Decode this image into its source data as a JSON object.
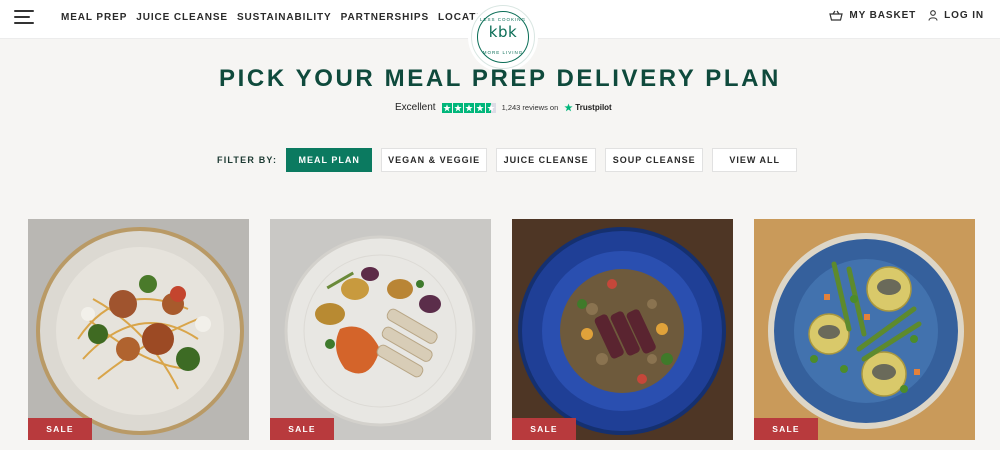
{
  "nav": {
    "items": [
      "MEAL PREP",
      "JUICE CLEANSE",
      "SUSTAINABILITY",
      "PARTNERSHIPS",
      "LOCATIONS"
    ],
    "basket_label": "MY BASKET",
    "login_label": "LOG IN"
  },
  "logo": {
    "mark": "kbk",
    "tagline_top": "LESS COOKING",
    "tagline_bottom": "MORE LIVING"
  },
  "page": {
    "title": "PICK YOUR MEAL PREP DELIVERY PLAN"
  },
  "trustpilot": {
    "rating_text": "Excellent",
    "stars": 4.5,
    "reviews_text": "1,243 reviews on",
    "brand": "Trustpilot"
  },
  "filter": {
    "label": "FILTER BY:",
    "options": [
      "MEAL PLAN",
      "VEGAN & VEGGIE",
      "JUICE CLEANSE",
      "SOUP CLEANSE",
      "VIEW ALL"
    ],
    "active": "MEAL PLAN"
  },
  "products": [
    {
      "badge": "SALE",
      "image": "spaghetti-chicken-dish"
    },
    {
      "badge": "SALE",
      "image": "roast-vegetables-chicken-dish"
    },
    {
      "badge": "SALE",
      "image": "steak-grain-salad-dish"
    },
    {
      "badge": "SALE",
      "image": "frittata-asparagus-dish"
    }
  ],
  "colors": {
    "brand_green": "#0b7a60",
    "heading_green": "#0f4a3c",
    "sale_red": "#b83a3d",
    "trustpilot_green": "#00b67a"
  }
}
